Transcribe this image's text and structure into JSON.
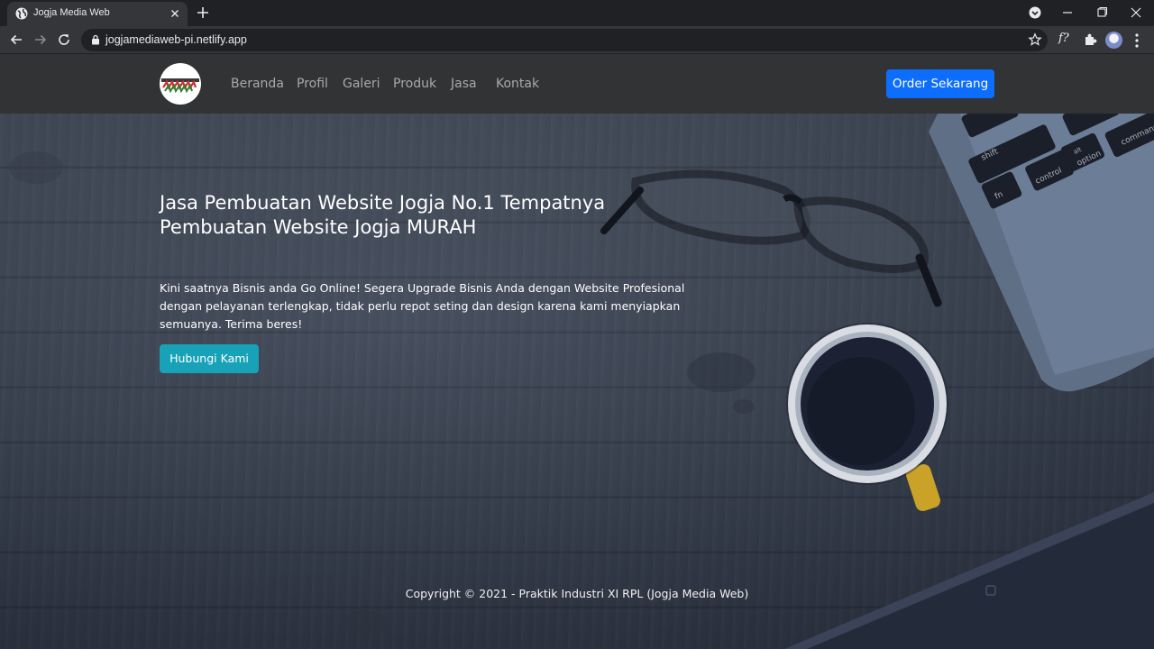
{
  "browser": {
    "tab_title": "Jogja Media Web",
    "url": "jogjamediaweb-pi.netlify.app",
    "extension_label": "f?"
  },
  "navbar": {
    "links": [
      "Beranda",
      "Profil",
      "Galeri",
      "Produk",
      "Jasa",
      "Kontak"
    ],
    "cta": "Order Sekarang"
  },
  "hero": {
    "title": "Jasa Pembuatan Website Jogja No.1 Tempatnya Pembuatan Website Jogja MURAH",
    "description": "Kini saatnya Bisnis anda Go Online! Segera Upgrade Bisnis Anda dengan Website Profesional dengan pelayanan terlengkap, tidak perlu repot seting dan design karena kami menyiapkan semuanya. Terima beres!",
    "button": "Hubungi Kami"
  },
  "footer": {
    "copyright": "Copyright © 2021 - Praktik Industri XI RPL (Jogja Media Web)"
  },
  "keyboard_keys": [
    "shift",
    "fn",
    "control",
    "alt",
    "option",
    "command"
  ],
  "colors": {
    "navbar_bg": "#323335",
    "order_button": "#0d6efd",
    "hubungi_button": "#17a2b8"
  }
}
